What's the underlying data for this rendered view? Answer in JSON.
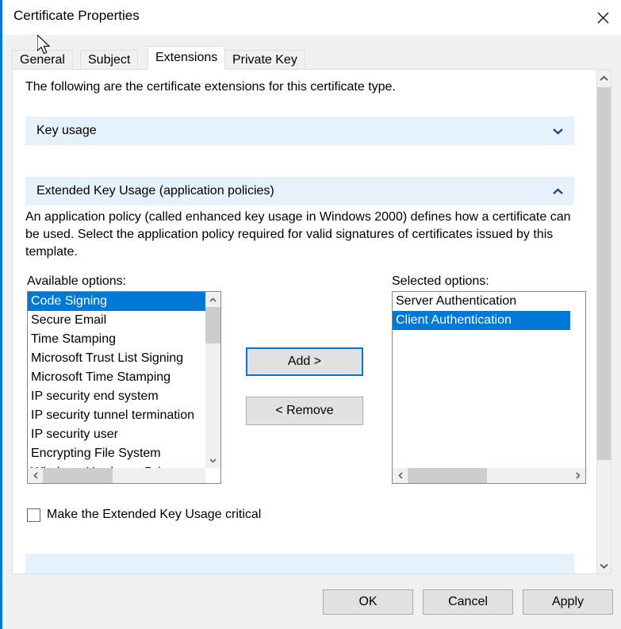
{
  "window": {
    "title": "Certificate Properties",
    "close_label": "✕"
  },
  "tabs": [
    {
      "label": "General",
      "selected": false
    },
    {
      "label": "Subject",
      "selected": false
    },
    {
      "label": "Extensions",
      "selected": true
    },
    {
      "label": "Private Key",
      "selected": false
    }
  ],
  "page": {
    "intro": "The following are the certificate extensions for this certificate type."
  },
  "sections": [
    {
      "id": "key_usage",
      "title": "Key usage",
      "expanded": false,
      "chevron": "chevron-down"
    },
    {
      "id": "extended_key_usage",
      "title": "Extended Key Usage (application policies)",
      "expanded": true,
      "chevron": "chevron-up"
    },
    {
      "id": "partial",
      "title": "",
      "expanded": false,
      "chevron": "chevron-down"
    }
  ],
  "eku": {
    "description": "An application policy (called enhanced key usage in Windows 2000) defines how a certificate can be used. Select the application policy required for valid signatures of certificates issued by this template.",
    "available_label": "Available options:",
    "selected_label": "Selected options:",
    "available_options": [
      {
        "label": "Code Signing",
        "selected": true
      },
      {
        "label": "Secure Email",
        "selected": false
      },
      {
        "label": "Time Stamping",
        "selected": false
      },
      {
        "label": "Microsoft Trust List Signing",
        "selected": false
      },
      {
        "label": "Microsoft Time Stamping",
        "selected": false
      },
      {
        "label": "IP security end system",
        "selected": false
      },
      {
        "label": "IP security tunnel termination",
        "selected": false
      },
      {
        "label": "IP security user",
        "selected": false
      },
      {
        "label": "Encrypting File System",
        "selected": false
      },
      {
        "label": "Windows Hardware Driver",
        "selected": false
      }
    ],
    "selected_options": [
      {
        "label": "Server Authentication",
        "selected": false
      },
      {
        "label": "Client Authentication",
        "selected": true
      }
    ],
    "add_label": "Add >",
    "remove_label": "< Remove",
    "critical_checkbox": {
      "label": "Make the Extended Key Usage critical",
      "checked": false
    }
  },
  "footer": {
    "ok_label": "OK",
    "cancel_label": "Cancel",
    "apply_label": "Apply"
  },
  "colors": {
    "accent": "#0078d7",
    "section_header_bg": "#e5f1fb",
    "dialog_bg": "#f0f0f0",
    "button_bg": "#e1e1e1",
    "scrollbar_thumb": "#cdcdcd"
  }
}
